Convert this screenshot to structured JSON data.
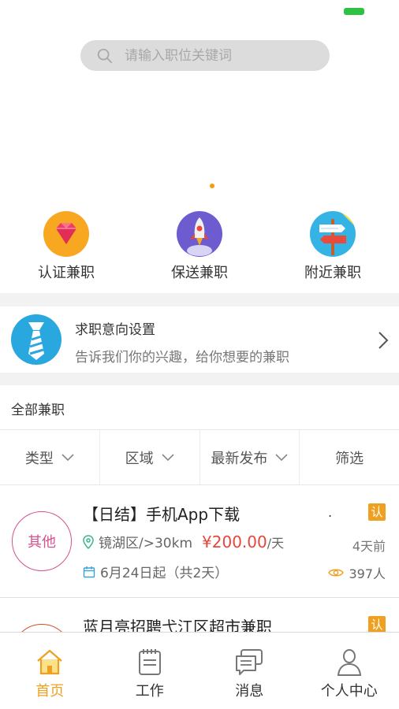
{
  "search": {
    "placeholder": "请输入职位关键词"
  },
  "quick_links": [
    {
      "label": "认证兼职",
      "icon": "diamond-icon"
    },
    {
      "label": "保送兼职",
      "icon": "rocket-icon"
    },
    {
      "label": "附近兼职",
      "icon": "signpost-icon"
    }
  ],
  "intent": {
    "title": "求职意向设置",
    "subtitle": "告诉我们你的兴趣，给你想要的兼职",
    "icon": "tie-icon"
  },
  "section": {
    "title": "全部兼职"
  },
  "filters": [
    {
      "label": "类型",
      "has_dropdown": true
    },
    {
      "label": "区域",
      "has_dropdown": true
    },
    {
      "label": "最新发布",
      "has_dropdown": true
    },
    {
      "label": "筛选",
      "has_dropdown": false
    }
  ],
  "jobs": [
    {
      "category": "其他",
      "title": "【日结】手机App下载",
      "dot": ".",
      "badge": "认",
      "area": "镜湖区/>30km",
      "price": "¥200.00",
      "unit": "/天",
      "ago": "4天前",
      "date": "6月24日起（共2天）",
      "views": "397人"
    },
    {
      "category": "",
      "title": "蓝月亮招聘弋江区超市兼职",
      "badge": "认"
    }
  ],
  "tabs": [
    {
      "label": "首页",
      "icon": "home-icon",
      "active": true
    },
    {
      "label": "工作",
      "icon": "notebook-icon",
      "active": false
    },
    {
      "label": "消息",
      "icon": "message-icon",
      "active": false
    },
    {
      "label": "个人中心",
      "icon": "person-icon",
      "active": false
    }
  ],
  "colors": {
    "accent": "#f0a020",
    "price": "#e8453c",
    "category_border": "#d4508f",
    "intent_icon_bg": "#29a8e0"
  }
}
